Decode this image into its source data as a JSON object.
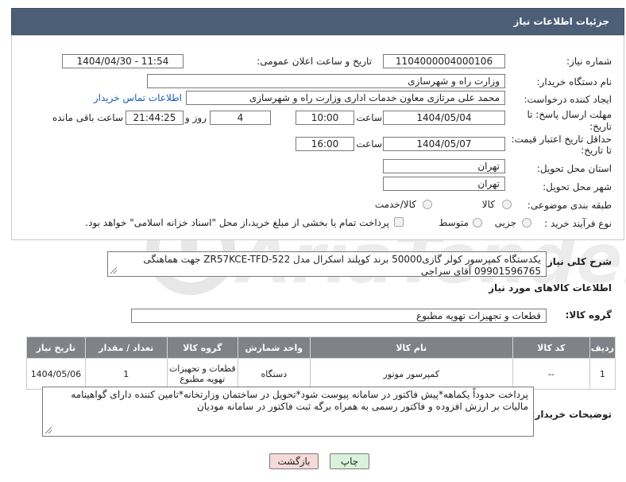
{
  "panel_title": "جزئیات اطلاعات نیاز",
  "fields": {
    "need_number_label": "شماره نیاز:",
    "need_number": "1104000004000106",
    "announce_label": "تاریخ و ساعت اعلان عمومی:",
    "announce_value": "1404/04/30 - 11:54",
    "buyer_org_label": "نام دستگاه خریدار:",
    "buyer_org": "وزارت راه و شهرسازی",
    "creator_label": "ایجاد کننده درخواست:",
    "creator": "محمد علی  مرتازی معاون خدمات اداری وزارت راه و شهرسازی",
    "contact_link": "اطلاعات تماس خریدار",
    "deadline_label_1": "مهلت ارسال پاسخ: تا",
    "deadline_label_2": "تاریخ:",
    "deadline_date": "1404/05/04",
    "time_label": "ساعت",
    "deadline_time": "10:00",
    "days_value": "4",
    "days_label": "روز و",
    "remaining_time": "21:44:25",
    "remaining_label": "ساعت باقی مانده",
    "min_validity_label_1": "حداقل تاریخ اعتبار قیمت:",
    "min_validity_label_2": "تا تاریخ:",
    "validity_date": "1404/05/07",
    "validity_time_label": "ساعت",
    "validity_time": "16:00",
    "province_label": "استان محل تحویل:",
    "province": "تهران",
    "city_label": "شهر محل تحویل:",
    "city": "تهران",
    "category_label": "طبقه بندی موضوعی:",
    "category_options": [
      "کالا",
      "کالا/خدمت"
    ],
    "process_label": "نوع فرآیند خرید :",
    "process_options": [
      "جزیی",
      "متوسط"
    ],
    "payment_note": "پرداخت تمام یا بخشی از مبلغ خرید،از محل \"اسناد خزانه اسلامی\" خواهد بود."
  },
  "description": {
    "label": "شرح کلی نیاز:",
    "text": "یکدستگاه کمپرسور کولر گازی50000 برند کوپلند اسکرال مدل ZR57KCE-TFD-522 جهت هماهنگی 09901596765 آقای سراجی"
  },
  "goods_section_title": "اطلاعات کالاهای مورد نیاز",
  "goods_group": {
    "label": "گروه کالا:",
    "value": "قطعات و تجهیزات تهویه مطبوع"
  },
  "table": {
    "headers": [
      "ردیف",
      "کد کالا",
      "نام کالا",
      "واحد شمارش",
      "گروه کالا",
      "تعداد / مقدار",
      "تاریخ نیاز"
    ],
    "rows": [
      [
        "1",
        "--",
        "کمپرسور موتور",
        "دستگاه",
        "قطعات و تجهیزات تهویه مطبوع",
        "1",
        "1404/05/06"
      ]
    ]
  },
  "buyer_notes": {
    "label": "توضیحات خریدار:",
    "text": "پرداخت حدوداً یکماهه*پیش فاکتور در سامانه پیوست شود*تحویل در ساختمان وزارتخانه*تامین کننده دارای گواهینامه مالیات بر ارزش افزوده و فاکتور رسمی به همراه برگه ثبت فاکتور در سامانه مودیان"
  },
  "buttons": {
    "print": "چاپ",
    "back": "بازگشت"
  },
  "colors": {
    "header_bg": "#4d5f76",
    "table_header_bg": "#7f8286",
    "back_button_bg": "#f6d9d9",
    "print_button_bg": "#d9f2d9"
  }
}
